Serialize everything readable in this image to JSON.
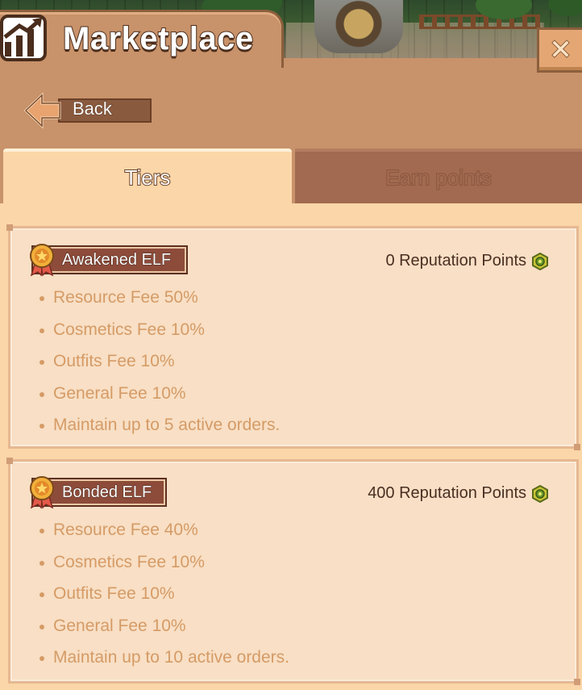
{
  "header": {
    "title": "Marketplace",
    "close_icon": "close-icon",
    "title_icon": "chart-up-icon"
  },
  "nav": {
    "back_label": "Back"
  },
  "tabs": [
    {
      "label": "Tiers",
      "active": true
    },
    {
      "label": "Earn points",
      "active": false
    }
  ],
  "tiers": [
    {
      "name": "Awakened ELF",
      "reputation": "0 Reputation Points",
      "perks": [
        "Resource Fee 50%",
        "Cosmetics Fee 10%",
        "Outfits Fee 10%",
        "General Fee 10%",
        "Maintain up to 5 active orders."
      ]
    },
    {
      "name": "Bonded ELF",
      "reputation": "400 Reputation Points",
      "perks": [
        "Resource Fee 40%",
        "Cosmetics Fee 10%",
        "Outfits Fee 10%",
        "General Fee 10%",
        "Maintain up to 10 active orders."
      ]
    }
  ],
  "colors": {
    "panel": "#c8926a",
    "active_tab": "#fbd6a8",
    "inactive_tab": "#a26a50",
    "card": "#f8dfc5",
    "perk_text": "#d59b66",
    "badge": "#8d4b3a"
  }
}
